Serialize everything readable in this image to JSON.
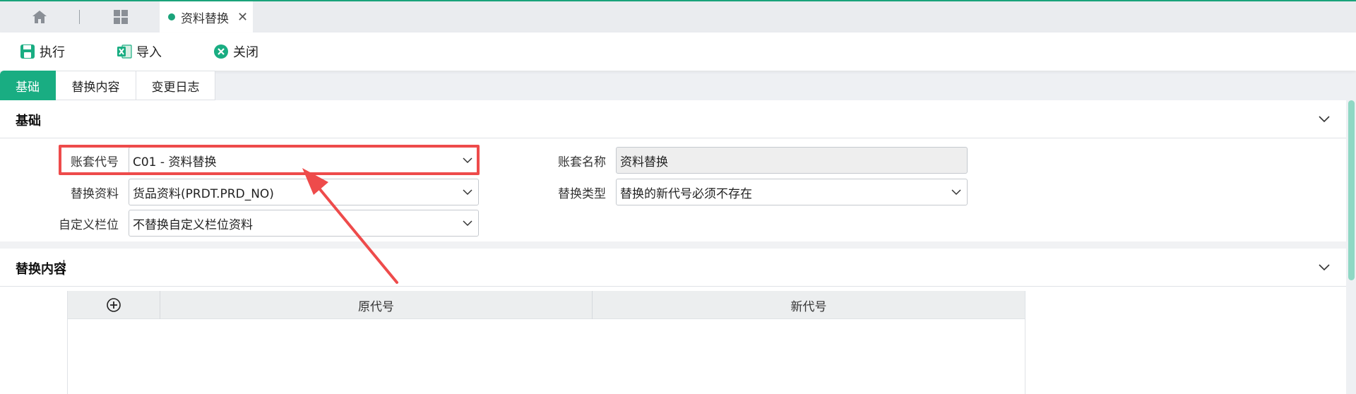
{
  "tabs": {
    "home_icon": "home-icon",
    "apps_icon": "grid-apps-icon",
    "doc_tab_label": "资料替换",
    "close_glyph": "✕"
  },
  "toolbar": {
    "exec_label": "执行",
    "import_label": "导入",
    "close_label": "关闭"
  },
  "subtabs": {
    "basic": "基础",
    "replace": "替换内容",
    "log": "变更日志"
  },
  "section_basic": {
    "title": "基础",
    "fields": {
      "acct_code_label": "账套代号",
      "acct_code_value": "C01 - 资料替换",
      "acct_name_label": "账套名称",
      "acct_name_value": "资料替换",
      "replace_data_label": "替换资料",
      "replace_data_value": "货品资料(PRDT.PRD_NO)",
      "replace_type_label": "替换类型",
      "replace_type_value": "替换的新代号必须不存在",
      "custom_label": "自定义栏位",
      "custom_value": "不替换自定义栏位资料"
    }
  },
  "section_replace": {
    "title": "替换内容",
    "columns": [
      "原代号",
      "新代号"
    ],
    "rows": []
  },
  "colors": {
    "accent": "#19ad82",
    "highlight": "#ee4b4b",
    "scroll_thumb": "#8fd8c4"
  }
}
